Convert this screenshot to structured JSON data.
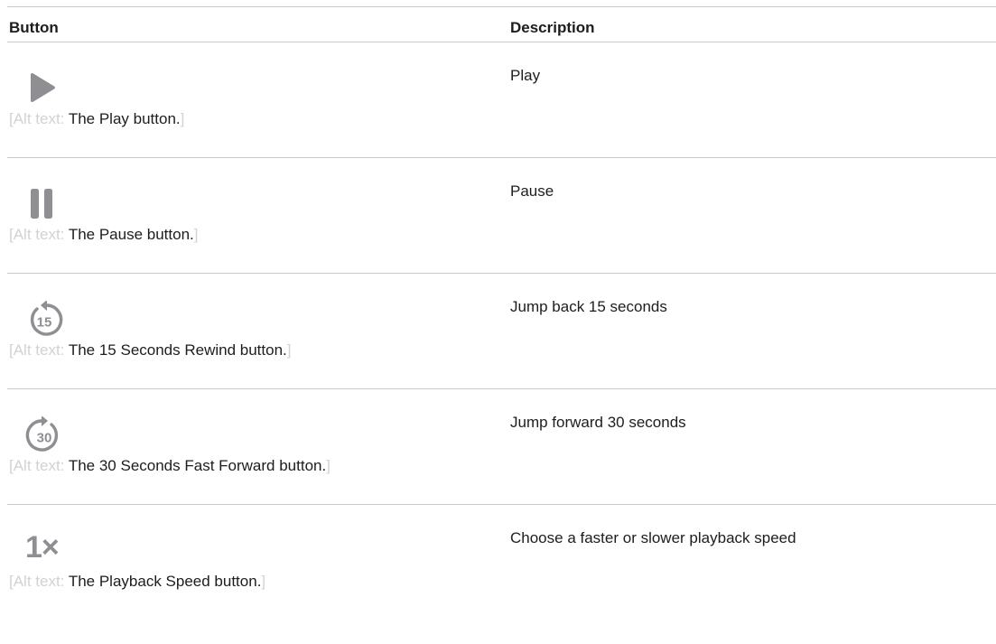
{
  "header": {
    "button_col": "Button",
    "description_col": "Description"
  },
  "alt_prefix": "[Alt text: ",
  "alt_suffix": "]",
  "rows": [
    {
      "icon": "play-icon",
      "alt": "The Play button.",
      "description": "Play"
    },
    {
      "icon": "pause-icon",
      "alt": "The Pause button.",
      "description": "Pause"
    },
    {
      "icon": "rewind-15-icon",
      "icon_label": "15",
      "alt": "The 15 Seconds Rewind button.",
      "description": "Jump back 15 seconds"
    },
    {
      "icon": "forward-30-icon",
      "icon_label": "30",
      "alt": "The 30 Seconds Fast Forward button.",
      "description": "Jump forward 30 seconds"
    },
    {
      "icon": "playback-speed-icon",
      "icon_label": "1×",
      "alt": "The Playback Speed button.",
      "description": "Choose a faster or slower playback speed"
    }
  ],
  "colors": {
    "icon_gray": "#8e8e93",
    "alt_bracket_gray": "#d2d2d7",
    "rule_gray": "#c8c8c8",
    "text": "#1d1d1f"
  }
}
